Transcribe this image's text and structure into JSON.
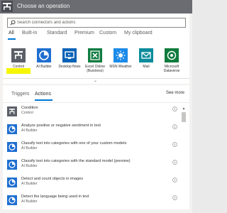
{
  "header": {
    "title": "Choose an operation",
    "icon": "operation-icon",
    "background": "#6a6c72"
  },
  "search": {
    "placeholder": "Search connectors and actions",
    "value": ""
  },
  "category_tabs": [
    {
      "label": "All",
      "selected": true
    },
    {
      "label": "Built-in"
    },
    {
      "label": "Standard"
    },
    {
      "label": "Premium"
    },
    {
      "label": "Custom"
    },
    {
      "label": "My clipboard"
    }
  ],
  "connectors": [
    {
      "label": "Control",
      "icon": "control-icon",
      "color": "#5b5f68"
    },
    {
      "label": "AI Builder",
      "icon": "ai-builder-icon",
      "color": "#1f6fd0"
    },
    {
      "label": "Desktop flows",
      "icon": "desktop-flows-icon",
      "color": "#0a62b7"
    },
    {
      "label": "Excel Online (Business)",
      "icon": "excel-icon",
      "color": "#107c41"
    },
    {
      "label": "MSN Weather",
      "icon": "weather-icon",
      "color": "#1b8ae8"
    },
    {
      "label": "Mail",
      "icon": "mail-icon",
      "color": "#0a8c9c"
    },
    {
      "label": "Microsoft Dataverse",
      "icon": "dataverse-icon",
      "color": "#0f7b3c"
    }
  ],
  "action_tabs": [
    {
      "label": "Triggers"
    },
    {
      "label": "Actions",
      "selected": true
    }
  ],
  "see_more": "See more",
  "actions": [
    {
      "title": "Condition",
      "subtitle": "Control",
      "icon": "control-icon",
      "color": "#5b5f68"
    },
    {
      "title": "Analyze positive or negative sentiment in text",
      "subtitle": "AI Builder",
      "icon": "ai-builder-icon",
      "color": "#1f6fd0"
    },
    {
      "title": "Classify text into categories with one of your custom models",
      "subtitle": "AI Builder",
      "icon": "ai-builder-icon",
      "color": "#1f6fd0"
    },
    {
      "title": "Classify text into categories with the standard model (preview)",
      "subtitle": "AI Builder",
      "icon": "ai-builder-icon",
      "color": "#1f6fd0"
    },
    {
      "title": "Detect and count objects in images",
      "subtitle": "AI Builder",
      "icon": "ai-builder-icon",
      "color": "#1f6fd0"
    },
    {
      "title": "Detect the language being used in text",
      "subtitle": "AI Builder",
      "icon": "ai-builder-icon",
      "color": "#1f6fd0"
    }
  ],
  "accent": "#0078d4",
  "highlight_color": "#f6f600"
}
